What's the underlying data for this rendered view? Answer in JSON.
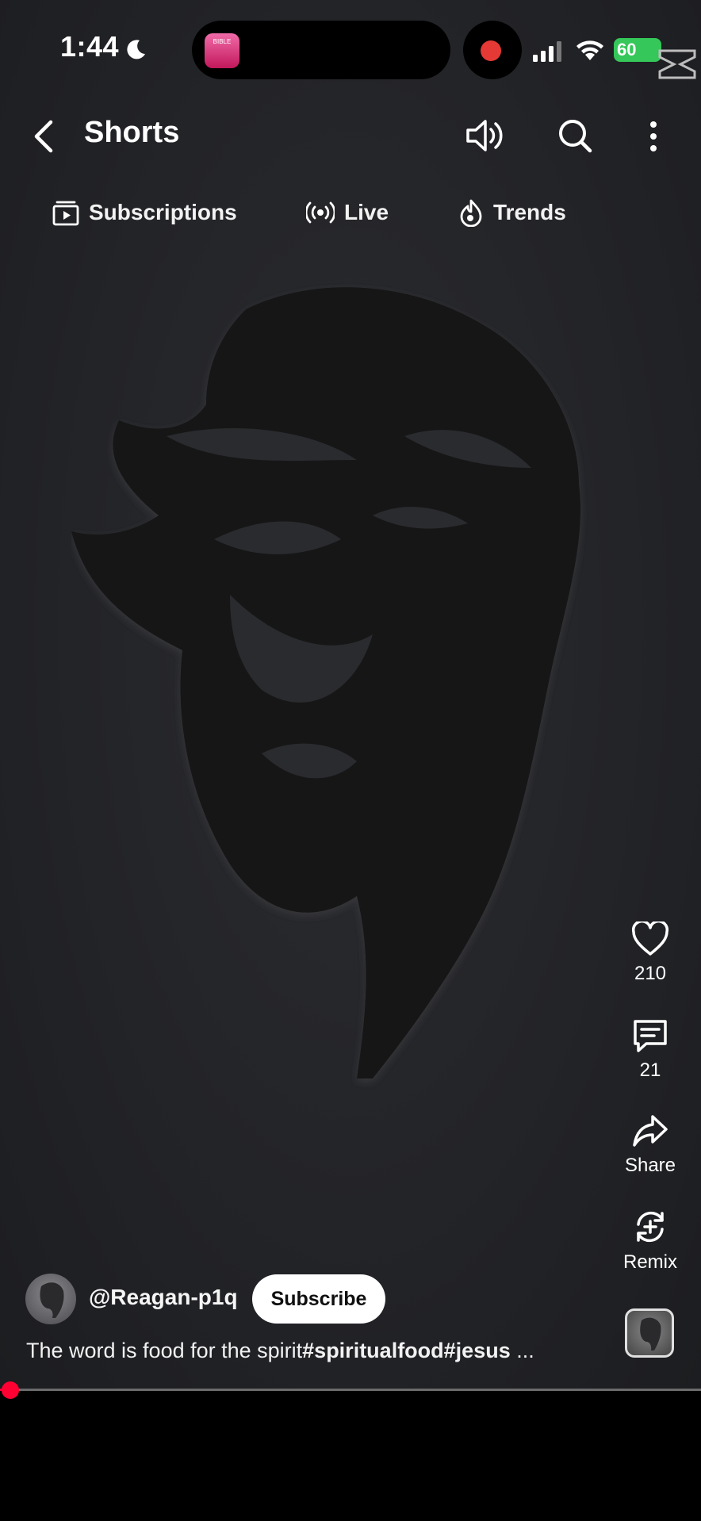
{
  "status_bar": {
    "time": "1:44",
    "battery": "60",
    "app_icon_text": "BIBLE"
  },
  "header": {
    "title": "Shorts"
  },
  "tabs": [
    {
      "label": "Subscriptions",
      "icon": "subscriptions-icon"
    },
    {
      "label": "Live",
      "icon": "live-icon"
    },
    {
      "label": "Trends",
      "icon": "trends-icon"
    }
  ],
  "actions": {
    "likes": "210",
    "comments": "21",
    "share_label": "Share",
    "remix_label": "Remix"
  },
  "channel": {
    "handle": "@Reagan-p1q",
    "subscribe_label": "Subscribe"
  },
  "caption": {
    "text": "The word is food for the spirit",
    "hashtags": "#spiritualfood#jesus",
    "ellipsis": " ..."
  },
  "progress": {
    "played_fraction": 0.01
  },
  "colors": {
    "accent": "#ff0033",
    "battery": "#35c759",
    "record": "#e53935"
  }
}
